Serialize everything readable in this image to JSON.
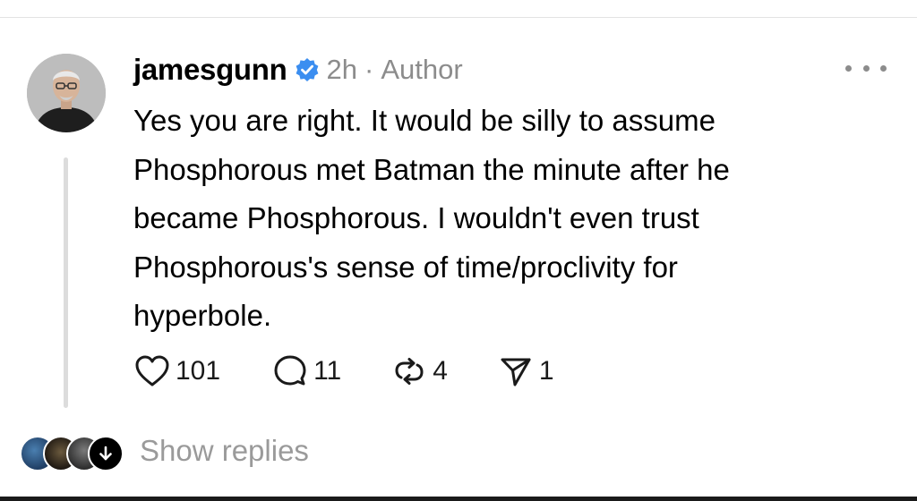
{
  "post": {
    "username": "jamesgunn",
    "time": "2h",
    "separator": "·",
    "role_badge": "Author",
    "verified": true,
    "text_lines": [
      "Yes you are right. It would be silly to assume",
      "Phosphorous met Batman the minute after he",
      "became Phosphorous. I wouldn't even trust",
      "Phosphorous's sense of time/proclivity for",
      "hyperbole."
    ]
  },
  "actions": {
    "likes": "101",
    "comments": "11",
    "reposts": "4",
    "shares": "1"
  },
  "replies": {
    "label": "Show replies"
  },
  "icons": [
    "avatar",
    "verified-icon",
    "more-icon",
    "heart-icon",
    "comment-icon",
    "repost-icon",
    "share-icon",
    "arrow-down-icon"
  ],
  "colors": {
    "verified": "#3b8ef0",
    "meta": "#8c8c8c",
    "thread_line": "#dcdcdc"
  }
}
